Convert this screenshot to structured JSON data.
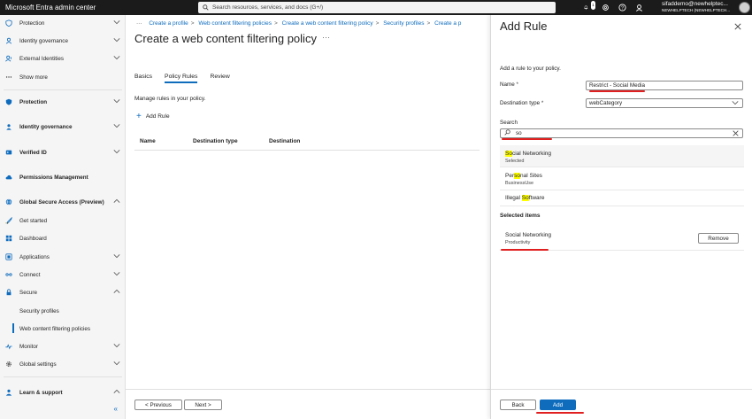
{
  "app": {
    "title": "Microsoft Entra admin center",
    "search_placeholder": "Search resources, services, and docs (G+/)",
    "notification_count": "1",
    "user_name": "sifaddemo@newhelptec...",
    "user_tenant": "NEWHELPTECH (NEWHELPTECH..."
  },
  "sidebar": {
    "items": [
      {
        "label": "Protection"
      },
      {
        "label": "Identity governance"
      },
      {
        "label": "External Identities"
      },
      {
        "label": "Show more"
      },
      {
        "label": "Protection"
      },
      {
        "label": "Identity governance"
      },
      {
        "label": "Verified ID"
      },
      {
        "label": "Permissions Management"
      },
      {
        "label": "Global Secure Access (Preview)"
      },
      {
        "label": "Get started"
      },
      {
        "label": "Dashboard"
      },
      {
        "label": "Applications"
      },
      {
        "label": "Connect"
      },
      {
        "label": "Secure"
      },
      {
        "label": "Security profiles"
      },
      {
        "label": "Web content filtering policies"
      },
      {
        "label": "Monitor"
      },
      {
        "label": "Global settings"
      },
      {
        "label": "Learn & support"
      }
    ],
    "collapse_label": "«"
  },
  "main": {
    "breadcrumb": {
      "ellipsis": "···",
      "items": [
        "Create a profile",
        "Web content filtering policies",
        "Create a web content filtering policy",
        "Security profiles",
        "Create a p"
      ]
    },
    "title": "Create a web content filtering policy",
    "title_more": "···",
    "tabs": [
      {
        "label": "Basics"
      },
      {
        "label": "Policy Rules"
      },
      {
        "label": "Review"
      }
    ],
    "manage_text": "Manage rules in your policy.",
    "add_rule_label": "Add Rule",
    "table_headers": [
      "Name",
      "Destination type",
      "Destination"
    ],
    "previous_label": "< Previous",
    "next_label": "Next >"
  },
  "panel": {
    "title": "Add Rule",
    "description": "Add a rule to your policy.",
    "name_label": "Name",
    "name_value": "Restrict - Social Media",
    "destination_label": "Destination type",
    "destination_value": "webCategory",
    "search_label": "Search",
    "search_value": "so",
    "results": [
      {
        "pre": "",
        "hl": "So",
        "post": "cial Networking",
        "sub": "Selected"
      },
      {
        "pre": "Per",
        "hl": "so",
        "post": "nal Sites",
        "sub": "BusinessUse"
      },
      {
        "pre": "Illegal ",
        "hl": "So",
        "post": "ftware",
        "sub": ""
      }
    ],
    "selected_heading": "Selected items",
    "selected_item": {
      "name": "Social Networking",
      "sub": "Productivity"
    },
    "remove_label": "Remove",
    "back_label": "Back",
    "add_label": "Add"
  },
  "colors": {
    "accent": "#0f6cbd",
    "highlight": "#ffff00",
    "annotation_red": "#e02020",
    "topbar": "#1b1b1b"
  }
}
